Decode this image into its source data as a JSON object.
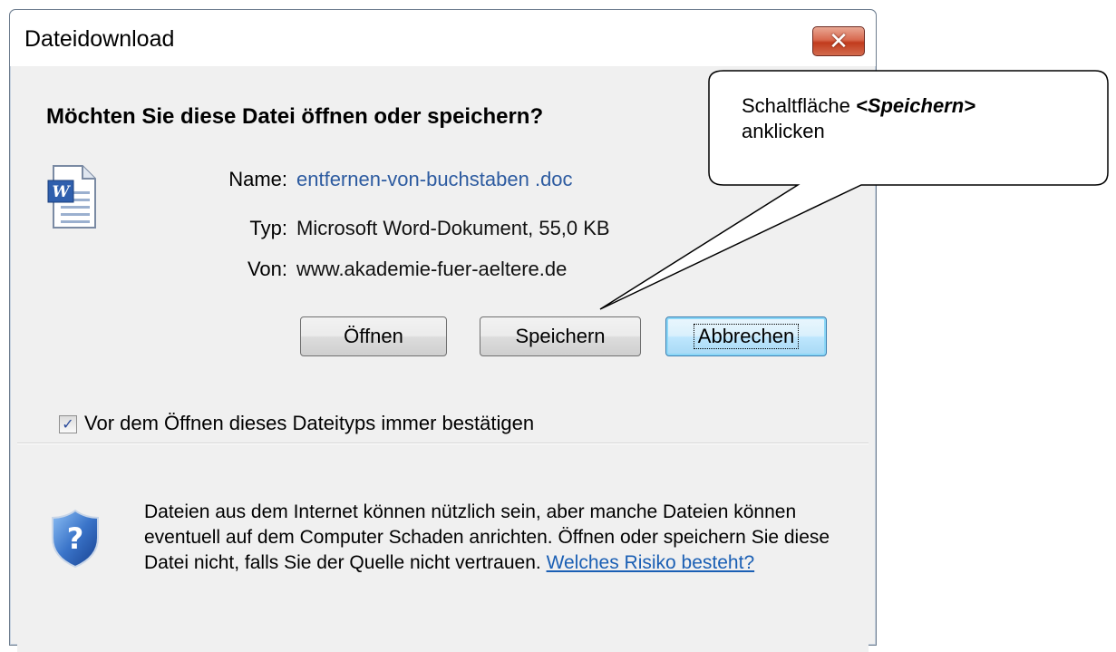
{
  "window": {
    "title": "Dateidownload",
    "close_label": "✕"
  },
  "dialog": {
    "heading": "Möchten Sie diese Datei öffnen oder speichern?",
    "fields": [
      {
        "label": "Name:",
        "value": "entfernen-von-buchstaben .doc"
      },
      {
        "label": "Typ:",
        "value": "Microsoft Word-Dokument, 55,0 KB"
      },
      {
        "label": "Von:",
        "value": "www.akademie-fuer-aeltere.de"
      }
    ],
    "buttons": {
      "open": "Öffnen",
      "save": "Speichern",
      "cancel": "Abbrechen"
    },
    "checkbox": {
      "checked": true,
      "label": "Vor dem Öffnen dieses Dateityps immer bestätigen"
    },
    "file_icon": "word-document-icon",
    "shield_icon": "security-shield-question-icon"
  },
  "footer": {
    "text": "Dateien aus dem Internet können nützlich sein, aber manche Dateien können eventuell auf dem Computer Schaden anrichten. Öffnen oder speichern Sie diese Datei nicht, falls Sie der Quelle nicht vertrauen.",
    "link": "Welches Risiko besteht?"
  },
  "callout": {
    "text_prefix": "Schaltfläche ",
    "text_emphasis": "<Speichern>",
    "text_suffix": "anklicken"
  },
  "colors": {
    "link": "#1a5fb4",
    "filename": "#2d5ba0",
    "close_button": "#c13b1d"
  }
}
